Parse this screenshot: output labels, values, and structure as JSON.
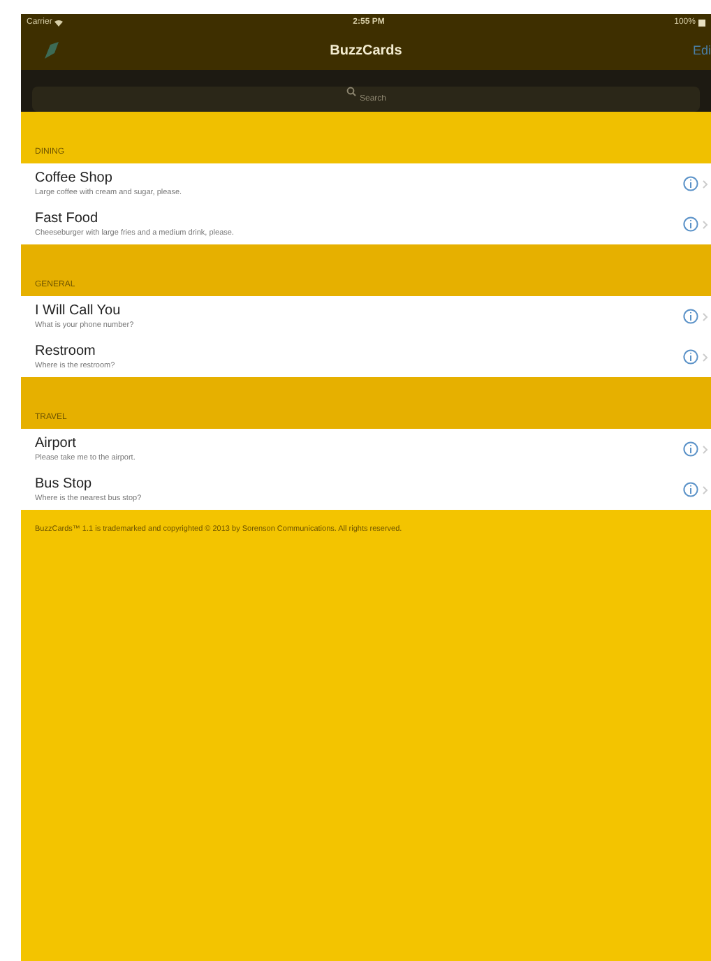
{
  "status_bar": {
    "carrier": "Carrier",
    "time": "2:55 PM",
    "battery": "100%"
  },
  "nav_bar": {
    "title": "BuzzCards",
    "edit": "Edi"
  },
  "search": {
    "placeholder": "Search"
  },
  "sections": [
    {
      "header": "DINING",
      "rows": [
        {
          "title": "Coffee Shop",
          "subtitle": "Large coffee with cream and sugar, please."
        },
        {
          "title": "Fast Food",
          "subtitle": "Cheeseburger with large fries and a medium drink, please."
        }
      ]
    },
    {
      "header": "GENERAL",
      "rows": [
        {
          "title": "I Will Call You",
          "subtitle": "What is your phone number?"
        },
        {
          "title": "Restroom",
          "subtitle": "Where is the restroom?"
        }
      ]
    },
    {
      "header": "TRAVEL",
      "rows": [
        {
          "title": "Airport",
          "subtitle": "Please take me to the airport."
        },
        {
          "title": "Bus Stop",
          "subtitle": "Where is the nearest bus stop?"
        }
      ]
    }
  ],
  "footer": "BuzzCards™ 1.1 is trademarked and copyrighted © 2013 by Sorenson Communications. All rights reserved."
}
